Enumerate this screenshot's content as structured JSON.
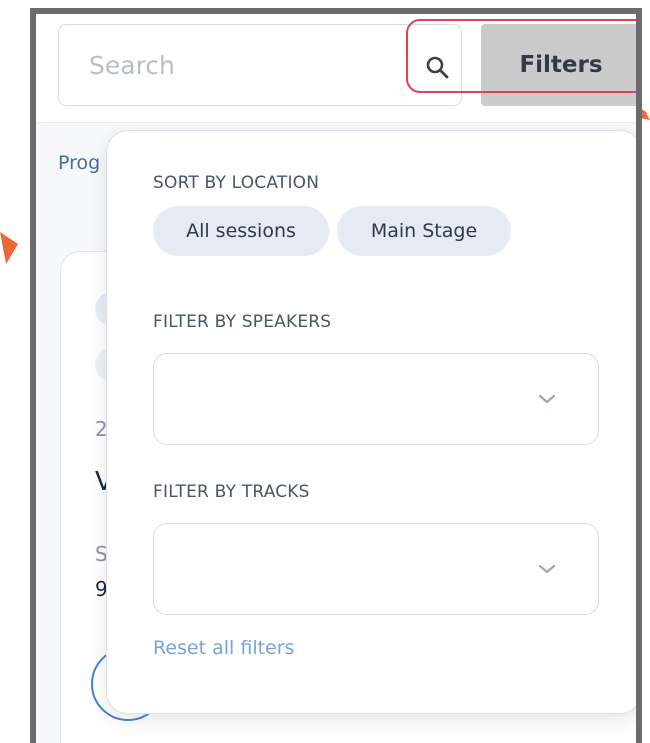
{
  "header": {
    "search_placeholder": "Search",
    "filters_label": "Filters"
  },
  "background": {
    "tab_fragment": "Prog",
    "card_fragments": [
      "2",
      "V",
      "S",
      "9"
    ]
  },
  "filter_panel": {
    "sort_by_location_label": "SORT BY LOCATION",
    "location_chips": [
      "All sessions",
      "Main Stage"
    ],
    "filter_by_speakers_label": "FILTER BY SPEAKERS",
    "speakers_value": "",
    "filter_by_tracks_label": "FILTER BY TRACKS",
    "tracks_value": "",
    "reset_label": "Reset all filters"
  },
  "colors": {
    "accent_highlight": "#e2434a",
    "annotation_arrow": "#e8683a",
    "link": "#7aa2d9",
    "chip_bg": "#e6ebf3"
  },
  "icons": [
    "search-icon",
    "chevron-down-icon",
    "chevron-down-icon"
  ]
}
